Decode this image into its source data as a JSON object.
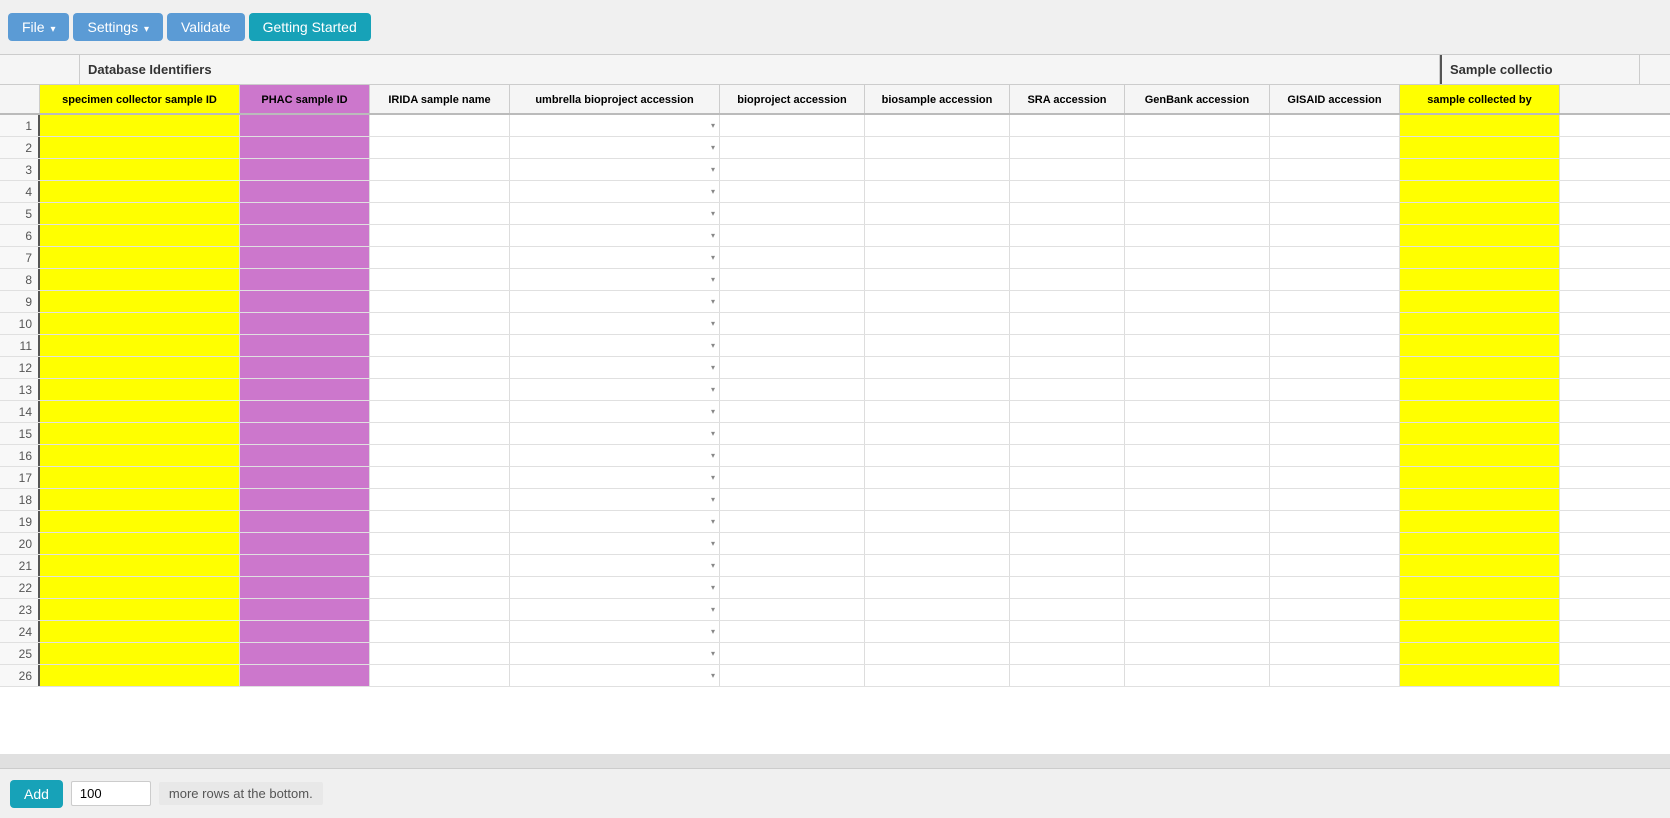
{
  "toolbar": {
    "file_label": "File",
    "settings_label": "Settings",
    "validate_label": "Validate",
    "getting_started_label": "Getting Started"
  },
  "sections": [
    {
      "label": "Database Identifiers",
      "colspan": 9
    },
    {
      "label": "Sample collectio",
      "colspan": 1
    }
  ],
  "columns": [
    {
      "id": "specimen",
      "label": "specimen collector sample ID",
      "class": "col-specimen",
      "has_dropdown": false
    },
    {
      "id": "phac",
      "label": "PHAC sample ID",
      "class": "col-phac",
      "has_dropdown": false
    },
    {
      "id": "irida",
      "label": "IRIDA sample name",
      "class": "col-irida",
      "has_dropdown": false
    },
    {
      "id": "umbrella",
      "label": "umbrella bioproject accession",
      "class": "col-umbrella",
      "has_dropdown": true
    },
    {
      "id": "bioproject",
      "label": "bioproject accession",
      "class": "col-bioproject",
      "has_dropdown": false
    },
    {
      "id": "biosample",
      "label": "biosample accession",
      "class": "col-biosample",
      "has_dropdown": false
    },
    {
      "id": "sra",
      "label": "SRA accession",
      "class": "col-sra",
      "has_dropdown": false
    },
    {
      "id": "genbank",
      "label": "GenBank accession",
      "class": "col-genbank",
      "has_dropdown": false
    },
    {
      "id": "gisaid",
      "label": "GISAID accession",
      "class": "col-gisaid",
      "has_dropdown": false
    },
    {
      "id": "sample_collected",
      "label": "sample collected by",
      "class": "col-sample-collected",
      "has_dropdown": false
    }
  ],
  "row_count": 26,
  "footer": {
    "add_label": "Add",
    "rows_value": "100",
    "more_rows_text": "more rows at the bottom."
  },
  "colors": {
    "getting_started_bg": "#17a2b8",
    "toolbar_btn_bg": "#5b9bd5"
  }
}
